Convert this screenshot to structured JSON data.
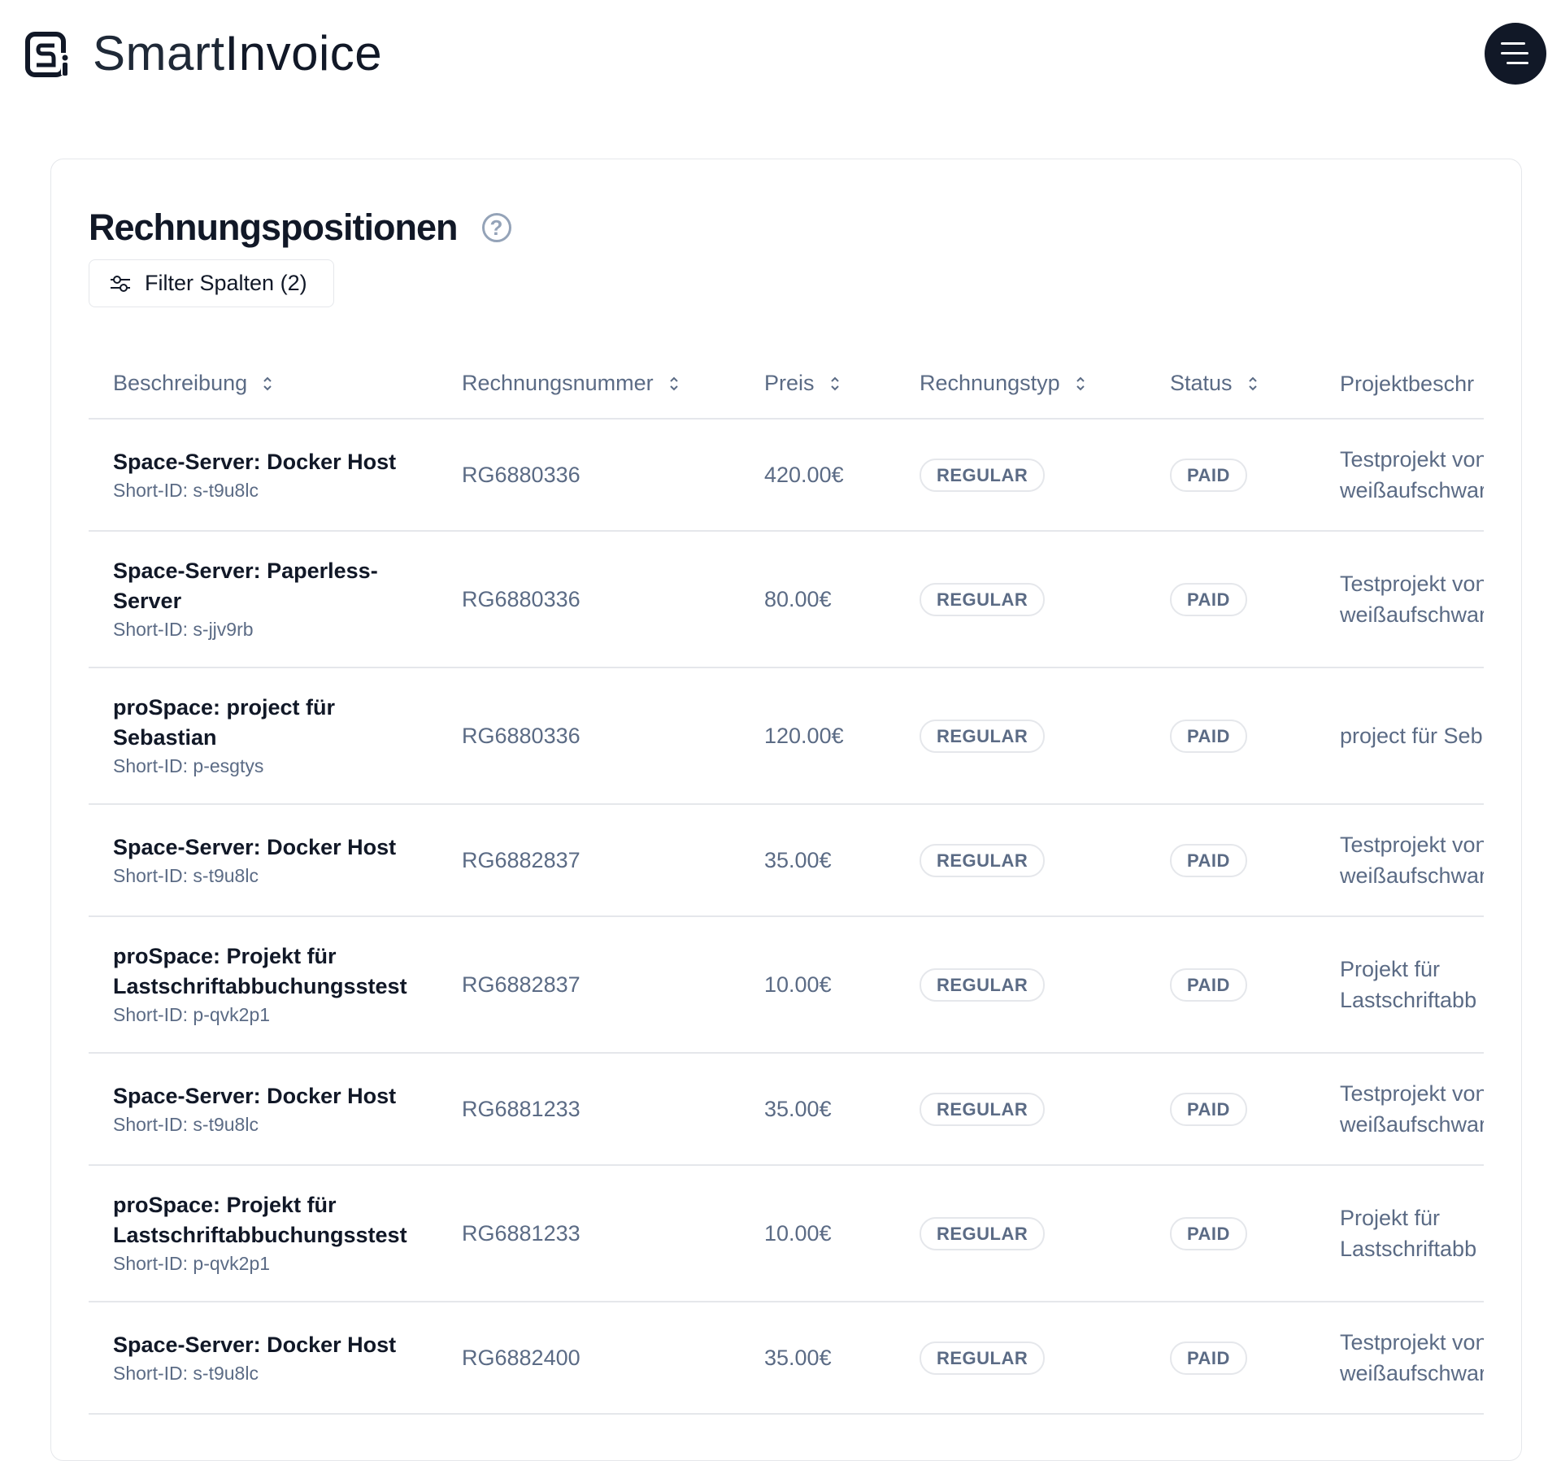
{
  "app": {
    "brand_light": "Smart",
    "brand_bold": "Invoice",
    "logo_icon": "si-logo"
  },
  "header": {
    "menu_icon": "hamburger-menu-icon"
  },
  "section": {
    "title": "Rechnungspositionen",
    "help_glyph": "?",
    "filter_label": "Filter Spalten (2)"
  },
  "table": {
    "columns": [
      "Beschreibung",
      "Rechnungsnummer",
      "Preis",
      "Rechnungstyp",
      "Status",
      "Projektbeschr"
    ],
    "rows": [
      {
        "title": "Space-Server: Docker Host",
        "short_id": "Short-ID: s-t9u8lc",
        "invoice": "RG6880336",
        "price": "420.00€",
        "type": "REGULAR",
        "status": "PAID",
        "project": [
          "Testprojekt von",
          "weißaufschwar"
        ]
      },
      {
        "title": "Space-Server: Paperless-Server",
        "short_id": "Short-ID: s-jjv9rb",
        "invoice": "RG6880336",
        "price": "80.00€",
        "type": "REGULAR",
        "status": "PAID",
        "project": [
          "Testprojekt von",
          "weißaufschwar"
        ]
      },
      {
        "title": "proSpace: project für Sebastian",
        "short_id": "Short-ID: p-esgtys",
        "invoice": "RG6880336",
        "price": "120.00€",
        "type": "REGULAR",
        "status": "PAID",
        "project": [
          "project für Seb",
          ""
        ]
      },
      {
        "title": "Space-Server: Docker Host",
        "short_id": "Short-ID: s-t9u8lc",
        "invoice": "RG6882837",
        "price": "35.00€",
        "type": "REGULAR",
        "status": "PAID",
        "project": [
          "Testprojekt von",
          "weißaufschwar"
        ]
      },
      {
        "title": "proSpace: Projekt für Lastschriftabbuchungsstest",
        "short_id": "Short-ID: p-qvk2p1",
        "invoice": "RG6882837",
        "price": "10.00€",
        "type": "REGULAR",
        "status": "PAID",
        "project": [
          "Projekt für",
          "Lastschriftabb"
        ]
      },
      {
        "title": "Space-Server: Docker Host",
        "short_id": "Short-ID: s-t9u8lc",
        "invoice": "RG6881233",
        "price": "35.00€",
        "type": "REGULAR",
        "status": "PAID",
        "project": [
          "Testprojekt von",
          "weißaufschwar"
        ]
      },
      {
        "title": "proSpace: Projekt für Lastschriftabbuchungsstest",
        "short_id": "Short-ID: p-qvk2p1",
        "invoice": "RG6881233",
        "price": "10.00€",
        "type": "REGULAR",
        "status": "PAID",
        "project": [
          "Projekt für",
          "Lastschriftabb"
        ]
      },
      {
        "title": "Space-Server: Docker Host",
        "short_id": "Short-ID: s-t9u8lc",
        "invoice": "RG6882400",
        "price": "35.00€",
        "type": "REGULAR",
        "status": "PAID",
        "project": [
          "Testprojekt von",
          "weißaufschwar"
        ]
      }
    ]
  }
}
